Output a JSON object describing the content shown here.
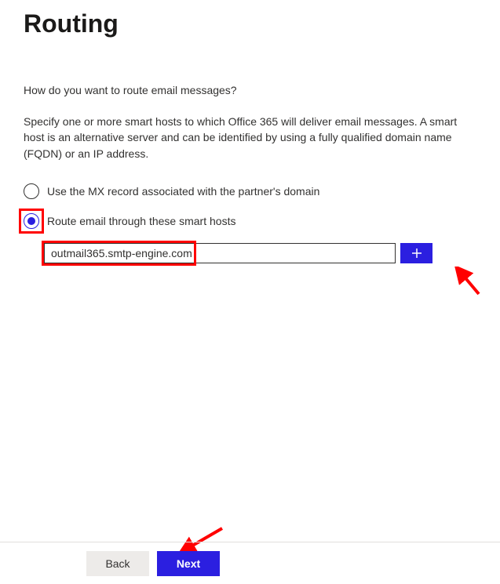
{
  "title": "Routing",
  "question": "How do you want to route email messages?",
  "description": "Specify one or more smart hosts to which Office 365 will deliver email messages. A smart host is an alternative server and can be identified by using a fully qualified domain name (FQDN) or an IP address.",
  "options": {
    "mx_record": {
      "label": "Use the MX record associated with the partner's domain",
      "selected": false
    },
    "smart_hosts": {
      "label": "Route email through these smart hosts",
      "selected": true
    }
  },
  "smart_host_input": {
    "value": "outmail365.smtp-engine.com"
  },
  "footer": {
    "back_label": "Back",
    "next_label": "Next"
  },
  "colors": {
    "accent": "#2b1fe0",
    "highlight": "#ff0000"
  }
}
